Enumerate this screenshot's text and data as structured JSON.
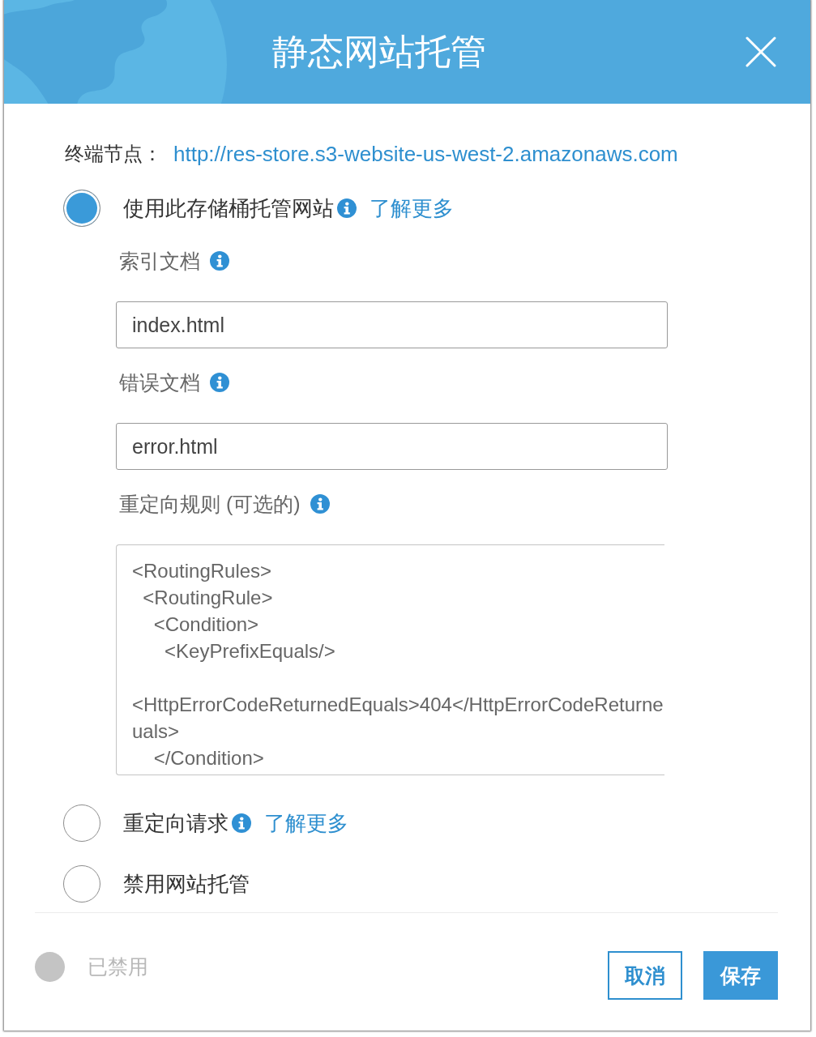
{
  "dialog": {
    "title": "静态网站托管"
  },
  "endpoint": {
    "label": "终端节点：",
    "url": "http://res-store.s3-website-us-west-2.amazonaws.com"
  },
  "options": [
    {
      "label": "使用此存储桶托管网站",
      "selected": true,
      "info": true,
      "link": "了解更多",
      "fields": [
        {
          "kind": "input",
          "label": "索引文档",
          "value": "index.html"
        },
        {
          "kind": "input",
          "label": "错误文档",
          "value": "error.html"
        },
        {
          "kind": "textarea",
          "label": "重定向规则 (可选的)",
          "value": "<RoutingRules>\n  <RoutingRule>\n    <Condition>\n      <KeyPrefixEquals/>\n\n<HttpErrorCodeReturnedEquals>404</HttpErrorCodeReturne\nuals>\n    </Condition>"
        }
      ]
    },
    {
      "label": "重定向请求",
      "selected": false,
      "info": true,
      "link": "了解更多"
    },
    {
      "label": "禁用网站托管",
      "selected": false,
      "info": false
    }
  ],
  "footer": {
    "status": {
      "label": "已禁用",
      "enabled": false
    },
    "buttons": [
      {
        "label": "取消",
        "kind": "secondary"
      },
      {
        "label": "保存",
        "kind": "primary"
      }
    ]
  }
}
